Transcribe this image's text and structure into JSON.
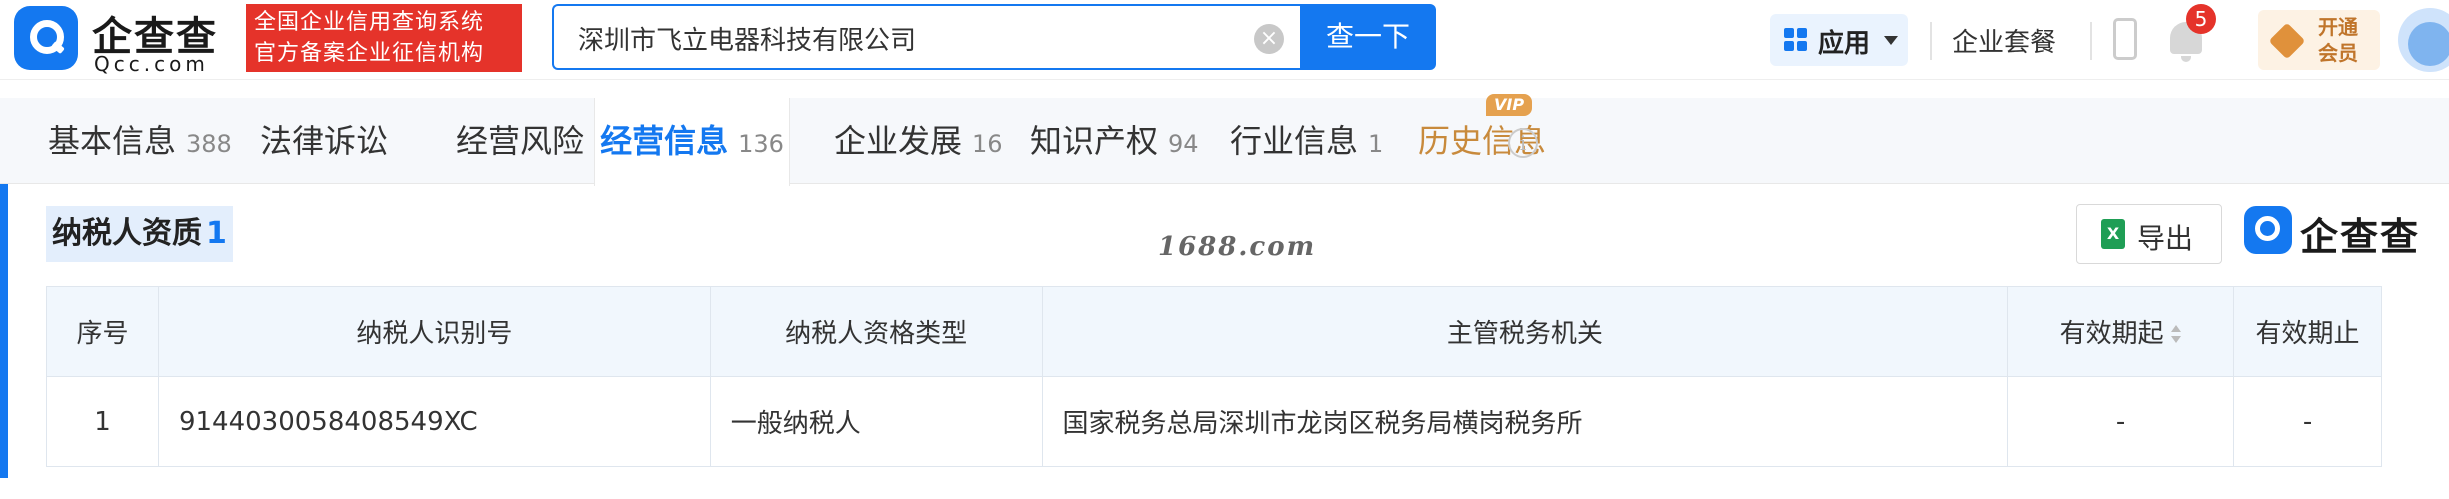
{
  "header": {
    "logo_text": "企查查",
    "logo_sub": "Qcc.com",
    "slogan_line1": "全国企业信用查询系统",
    "slogan_line2": "官方备案企业征信机构",
    "search_value": "深圳市飞立电器科技有限公司",
    "search_button": "查一下",
    "app_label": "应用",
    "suite_label": "企业套餐",
    "notification_count": "5",
    "vip_line1": "开通",
    "vip_line2": "会员"
  },
  "tabs": [
    {
      "label": "基本信息",
      "count": "388"
    },
    {
      "label": "法律诉讼",
      "count": ""
    },
    {
      "label": "经营风险",
      "count": ""
    },
    {
      "label": "经营信息",
      "count": "136"
    },
    {
      "label": "企业发展",
      "count": "16"
    },
    {
      "label": "知识产权",
      "count": "94"
    },
    {
      "label": "行业信息",
      "count": "1"
    },
    {
      "label": "历史信息",
      "count": ""
    }
  ],
  "active_tab": "经营信息",
  "vip_tag": "VIP",
  "section": {
    "title": "纳税人资质",
    "count": "1",
    "watermark": "1688.com",
    "export_label": "导出",
    "brand_text": "企查查"
  },
  "table": {
    "headers": [
      "序号",
      "纳税人识别号",
      "纳税人资格类型",
      "主管税务机关",
      "有效期起",
      "有效期止"
    ],
    "rows": [
      {
        "idx": "1",
        "tax_id": "9144030058408549XC",
        "type": "一般纳税人",
        "authority": "国家税务总局深圳市龙岗区税务局横岗税务所",
        "start": "-",
        "end": "-"
      }
    ]
  },
  "colors": {
    "accent": "#1478f0",
    "slogan_bg": "#e5332a",
    "history_tab": "#c88a3c"
  }
}
